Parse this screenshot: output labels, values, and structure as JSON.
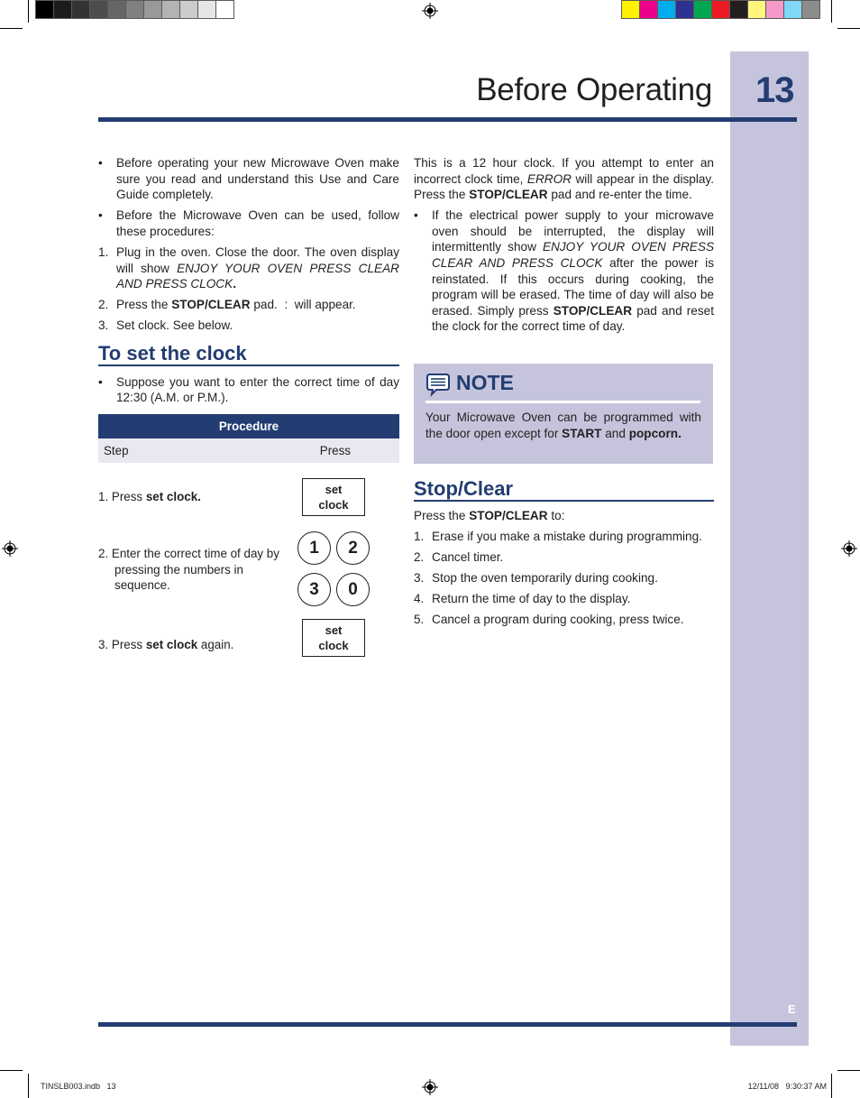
{
  "printer_marks": {
    "gray_swatches": [
      "#000000",
      "#1c1c1c",
      "#333333",
      "#4d4d4d",
      "#666666",
      "#808080",
      "#999999",
      "#b3b3b3",
      "#cccccc",
      "#e6e6e6",
      "#ffffff"
    ],
    "color_swatches": [
      "#fff200",
      "#ec008c",
      "#00aeef",
      "#2e3192",
      "#00a651",
      "#ed1c24",
      "#231f20",
      "#fff57c",
      "#f49ac9",
      "#80d8f8",
      "#8d8c8c"
    ]
  },
  "colors": {
    "brand_blue": "#233d72",
    "tab_lavender": "#c5c4dc"
  },
  "header": {
    "title": "Before Operating",
    "page_number": "13"
  },
  "intro": {
    "bullet1": "Before operating your new Microwave Oven make sure you read and understand this Use and Care Guide completely.",
    "bullet2": "Before the Microwave Oven can be used, follow these procedures:",
    "steps": [
      {
        "num": "1.",
        "pre": "Plug in the oven. Close the door. The oven display will show ",
        "italic": "ENJOY YOUR OVEN PRESS CLEAR AND PRESS CLOCK",
        "post": "."
      },
      {
        "num": "2.",
        "pre": "Press the ",
        "bold": "STOP/CLEAR",
        "post": " pad.  :  will appear."
      },
      {
        "num": "3.",
        "text": "Set clock. See below."
      }
    ]
  },
  "set_clock": {
    "heading": "To set the clock",
    "bullet": "Suppose you want to enter the correct time of day 12:30 (A.M. or P.M.).",
    "table_title": "Procedure",
    "col_step": "Step",
    "col_press": "Press",
    "rows": [
      {
        "pre": "1. Press ",
        "bold": "set clock.",
        "post": ""
      },
      {
        "text": "2. Enter the correct time of day by pressing the numbers in sequence."
      },
      {
        "pre": "3. Press ",
        "bold": "set clock",
        "post": " again."
      }
    ],
    "key_set_clock_line1": "set",
    "key_set_clock_line2": "clock",
    "number_keys": [
      "1",
      "2",
      "3",
      "0"
    ]
  },
  "clock_info": {
    "p_pre": "This is a 12 hour clock. If you attempt to enter an incorrect clock time, ",
    "p_italic": "ERROR",
    "p_mid": " will appear in the display. Press the ",
    "p_bold": "STOP/CLEAR",
    "p_post": " pad and re-enter the time.",
    "bullet_pre": "If the electrical power supply to your microwave oven should be interrupted, the display will intermittently show ",
    "bullet_italic": "ENJOY YOUR OVEN PRESS CLEAR AND PRESS CLOCK",
    "bullet_mid": " after the power is reinstated. If this occurs during cooking, the program will be erased. The time of day will also be erased. Simply press ",
    "bullet_bold": "STOP/CLEAR",
    "bullet_post": " pad and reset the clock for the correct time of day."
  },
  "note": {
    "title": "NOTE",
    "text_pre": "Your Microwave Oven can be programmed with the door open except for ",
    "bold1": "START",
    "text_mid": " and ",
    "bold2": "popcorn."
  },
  "stop_clear": {
    "heading": "Stop/Clear",
    "intro_pre": "Press the ",
    "intro_bold": "STOP/CLEAR",
    "intro_post": " to:",
    "items": [
      {
        "num": "1.",
        "text": "Erase if you make a mistake during programming."
      },
      {
        "num": "2.",
        "text": "Cancel timer."
      },
      {
        "num": "3.",
        "text": "Stop the oven temporarily during cooking."
      },
      {
        "num": "4.",
        "text": "Return the time of day to the display."
      },
      {
        "num": "5.",
        "text": "Cancel a program during cooking, press twice."
      }
    ]
  },
  "side_tab": {
    "language_letter": "E"
  },
  "footer": {
    "file": "TINSLB003.indb   13",
    "timestamp": "12/11/08   9:30:37 AM"
  }
}
